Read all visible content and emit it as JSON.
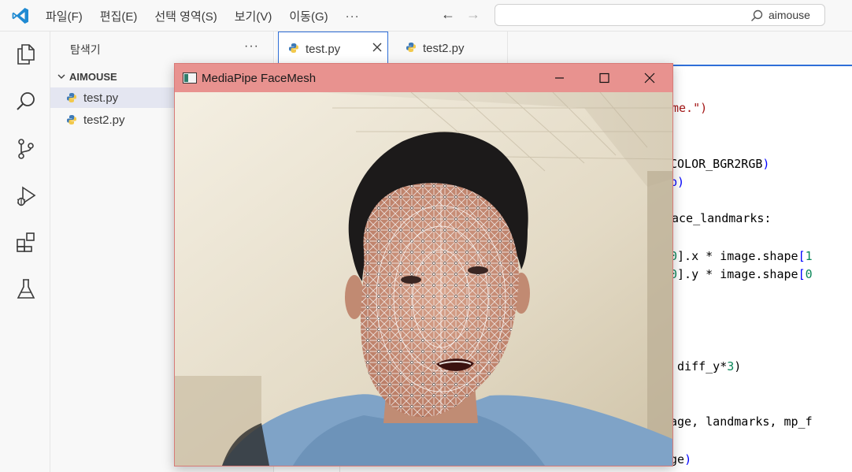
{
  "menu": {
    "items": [
      "파일(F)",
      "편집(E)",
      "선택 영역(S)",
      "보기(V)",
      "이동(G)"
    ],
    "more": "···"
  },
  "command_center": {
    "text": "aimouse"
  },
  "sidebar": {
    "title": "탐색기",
    "more": "···",
    "folder": "AIMOUSE",
    "files": [
      "test.py",
      "test2.py"
    ]
  },
  "tabs": [
    {
      "label": "test.py",
      "active": true
    },
    {
      "label": "test2.py",
      "active": false
    }
  ],
  "code_lines": [
    [
      [
        "str",
        "me.\")"
      ]
    ],
    [
      [
        "plain",
        "COLOR_BGR2RGB"
      ],
      [
        "kw",
        ")"
      ]
    ],
    [
      [
        "kw",
        "p)"
      ]
    ],
    [
      [
        "plain",
        "ace_landmarks:"
      ]
    ],
    [
      [
        "num",
        "0"
      ],
      [
        "plain",
        "].x * image.shape"
      ],
      [
        "kw",
        "["
      ],
      [
        "num",
        "1"
      ]
    ],
    [
      [
        "num",
        "0"
      ],
      [
        "plain",
        "].y * image.shape"
      ],
      [
        "kw",
        "["
      ],
      [
        "num",
        "0"
      ]
    ],
    [
      [
        "plain",
        " diff_y*"
      ],
      [
        "num",
        "3"
      ],
      [
        "plain",
        ")"
      ]
    ],
    [
      [
        "plain",
        "age, landmarks, mp_f"
      ]
    ],
    [
      [
        "plain",
        "ge"
      ],
      [
        "kw",
        ")"
      ]
    ]
  ],
  "mp_window": {
    "title": "MediaPipe FaceMesh",
    "bg_color": "#e8928f"
  },
  "colors": {
    "accent": "#2f6fd8",
    "python_blue": "#3d7ab8",
    "python_yellow": "#f2c94c"
  }
}
